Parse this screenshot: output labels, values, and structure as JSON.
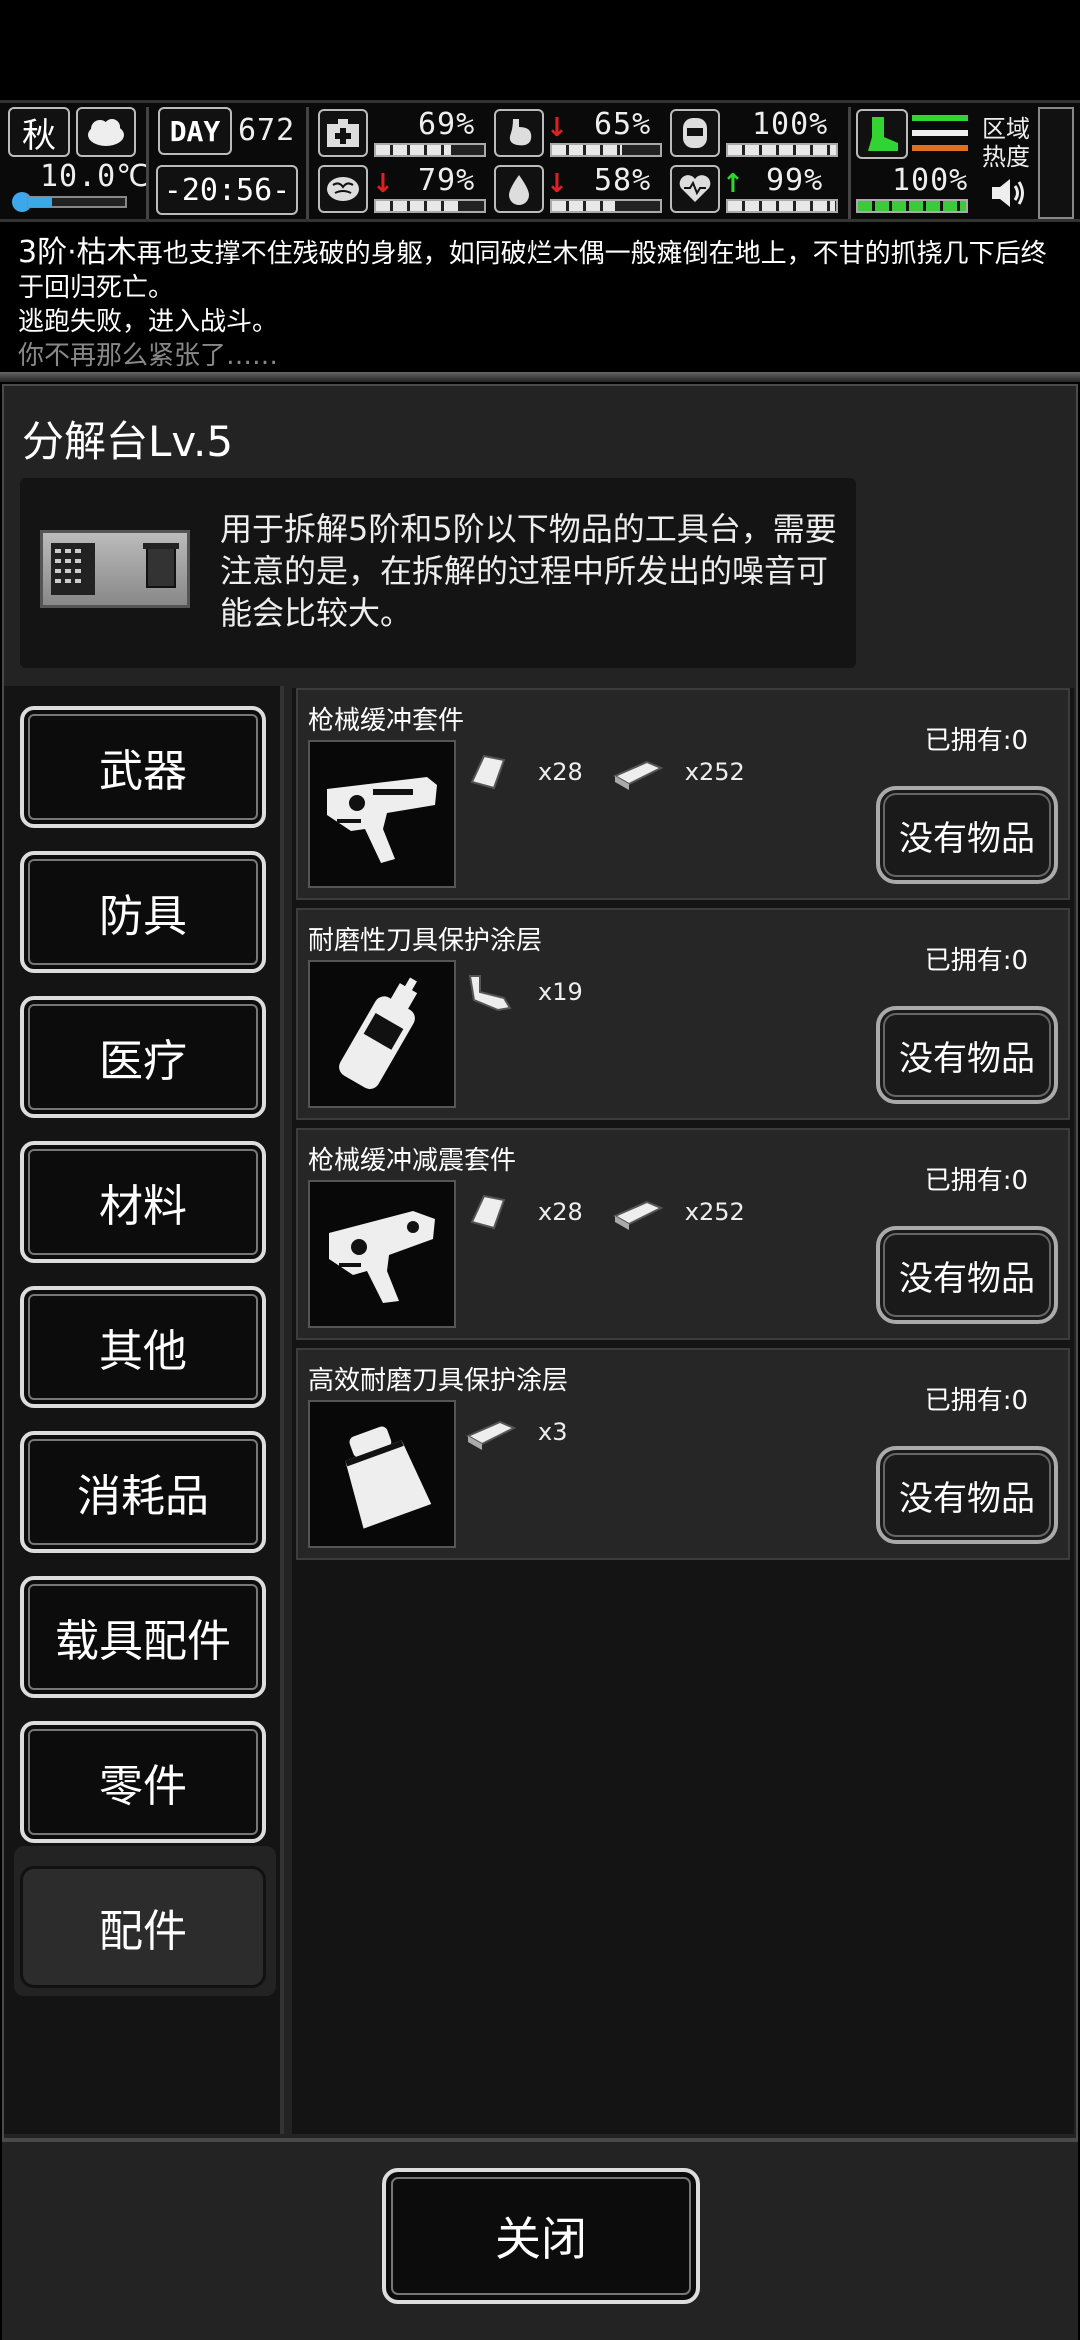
{
  "status": {
    "season": "秋",
    "temperature": "10.0℃",
    "day_label": "DAY",
    "day": "672",
    "time": "-20:56-",
    "health": "69%",
    "health_level": 0.69,
    "hunger": "65%",
    "hunger_level": 0.65,
    "water_armor": "100%",
    "water_armor_level": 1.0,
    "mental": "79%",
    "mental_level": 0.79,
    "thirst": "58%",
    "thirst_level": 0.58,
    "mood": "99%",
    "mood_level": 0.99,
    "stamina": "100%",
    "stamina_level": 1.0,
    "zone_heat_label": "区域热度"
  },
  "log": {
    "line1_prefix": "3阶·枯木",
    "line1_rest": "再也支撑不住残破的身躯，如同破烂木偶一般瘫倒在地上，不甘的抓挠几下后终于回归死亡。",
    "line2": "逃跑失败，进入战斗。",
    "line3": "你不再那么紧张了……"
  },
  "panel": {
    "title": "分解台Lv.5",
    "description": "用于拆解5阶和5阶以下物品的工具台，需要注意的是，在拆解的过程中所发出的噪音可能会比较大。"
  },
  "categories": [
    "武器",
    "防具",
    "医疗",
    "材料",
    "其他",
    "消耗品",
    "载具配件",
    "零件",
    "配件"
  ],
  "active_category": "配件",
  "items": [
    {
      "name": "枪械缓冲套件",
      "owned": "已拥有:0",
      "mat1_qty": "x28",
      "mat2_qty": "x252",
      "button": "没有物品"
    },
    {
      "name": "耐磨性刀具保护涂层",
      "owned": "已拥有:0",
      "mat1_qty": "x19",
      "button": "没有物品"
    },
    {
      "name": "枪械缓冲减震套件",
      "owned": "已拥有:0",
      "mat1_qty": "x28",
      "mat2_qty": "x252",
      "button": "没有物品"
    },
    {
      "name": "高效耐磨刀具保护涂层",
      "owned": "已拥有:0",
      "mat1_qty": "x3",
      "button": "没有物品"
    }
  ],
  "close_label": "关闭",
  "colors": {
    "accent_green": "#32d432",
    "alert_red": "#e02020",
    "temp_blue": "#3da8e8"
  }
}
